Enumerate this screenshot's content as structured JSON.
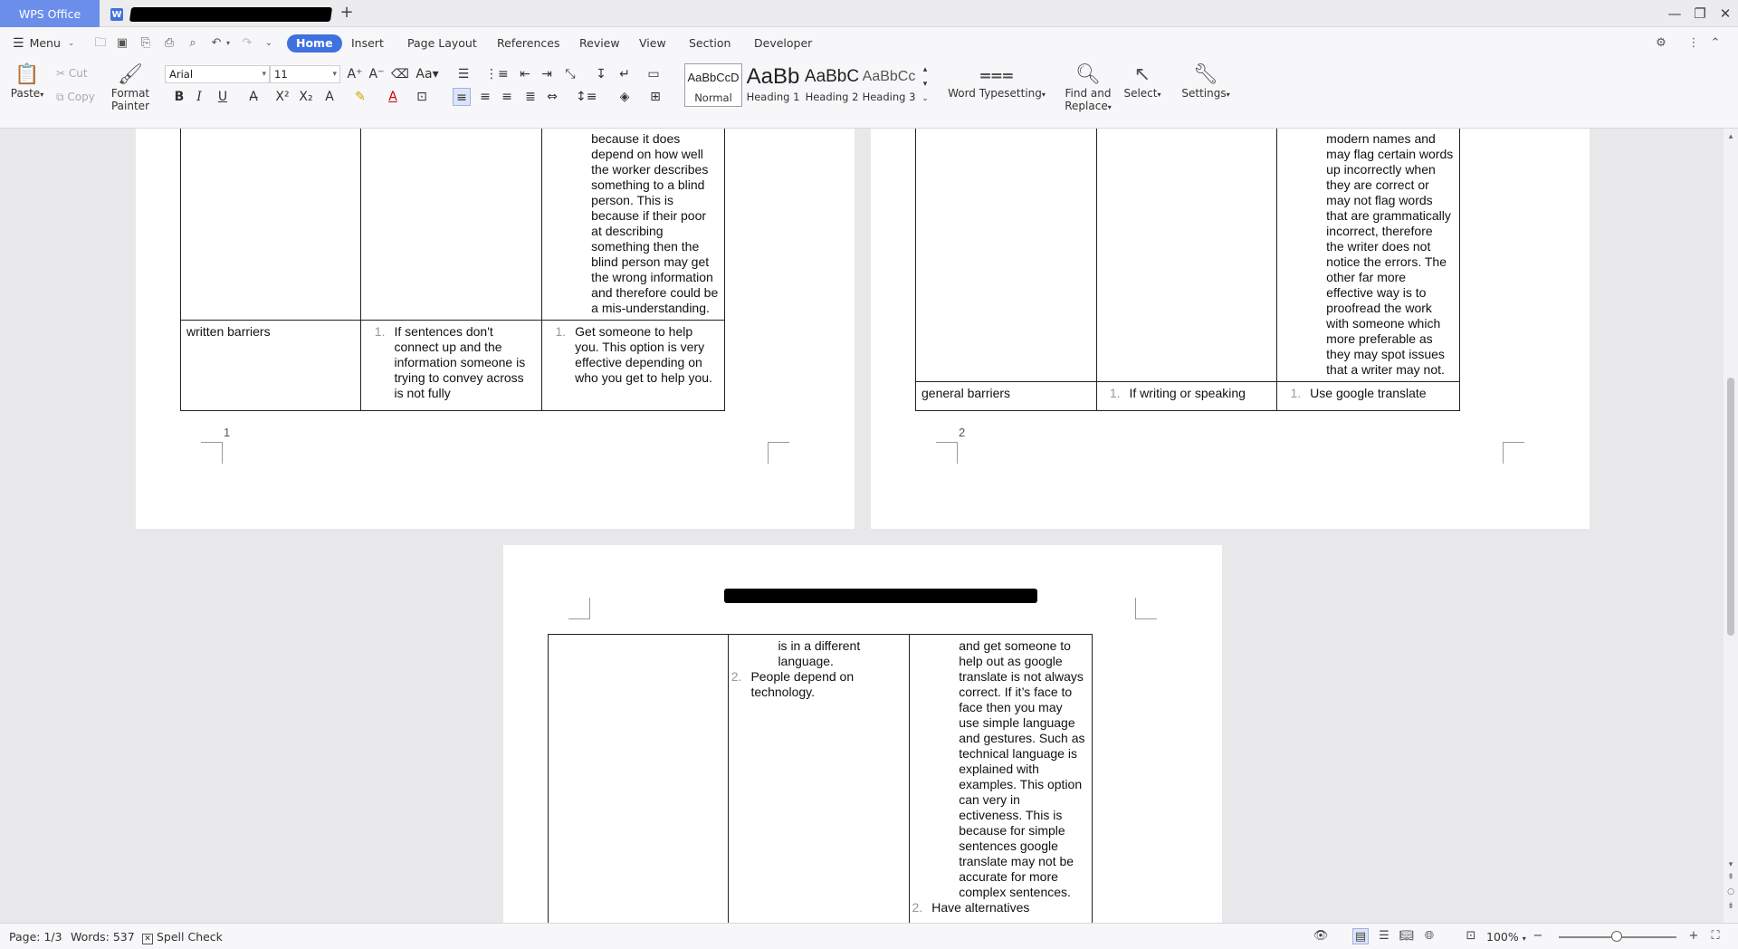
{
  "titlebar": {
    "app_tab": "WPS Office",
    "doc_icon": "W",
    "new_tab": "+",
    "minimize": "—",
    "restore": "❐",
    "close": "✕"
  },
  "menu": {
    "menu_label": "Menu",
    "tabs": [
      "Home",
      "Insert",
      "Page Layout",
      "References",
      "Review",
      "View",
      "Section",
      "Developer"
    ]
  },
  "ribbon": {
    "paste": "Paste",
    "cut": "Cut",
    "copy": "Copy",
    "format_painter_1": "Format",
    "format_painter_2": "Painter",
    "font_name": "Arial",
    "font_size": "11",
    "styles": [
      {
        "preview": "AaBbCcD",
        "label": "Normal"
      },
      {
        "preview": "AaBb",
        "label": "Heading 1"
      },
      {
        "preview": "AaBbC",
        "label": "Heading 2"
      },
      {
        "preview": "AaBbCc",
        "label": "Heading 3"
      }
    ],
    "word_typesetting": "Word Typesetting",
    "find_replace_1": "Find and",
    "find_replace_2": "Replace",
    "select": "Select",
    "settings": "Settings"
  },
  "pages": {
    "page1": {
      "row1_col3": "because it does depend on how well the worker describes something to a blind person. This is because if their poor at describing something then the blind person may get the wrong information and therefore could be a mis-understanding.",
      "row2_col1": "written barriers",
      "row2_col2_num": "1.",
      "row2_col2": "If sentences don't connect up and the information someone is trying to convey across is not fully",
      "row2_col3_num": "1.",
      "row2_col3": "Get someone to help you. This option is very effective depending on who you get to help you.",
      "page_number": "1"
    },
    "page2": {
      "row1_col3": "modern names and may flag certain words up incorrectly when they are correct or may not flag words that are grammatically incorrect, therefore the writer does not notice the errors. The other far more effective way is to proofread the work with someone which more preferable as they may spot issues that a writer may not.",
      "row2_col1": "general barriers",
      "row2_col2_num": "1.",
      "row2_col2": "If writing or speaking",
      "row2_col3_num": "1.",
      "row2_col3": "Use google translate",
      "page_number": "2"
    },
    "page3": {
      "col2_line1": "is in a different language.",
      "col2_num2": "2.",
      "col2_item2": "People depend on technology.",
      "col3_text": "and get someone to help out as google translate is not always correct. If it’s face to face then you may use simple language and gestures. Such as technical language is explained with examples. This option can very in ectiveness. This is because for simple sentences google translate may not be accurate for more complex sentences.",
      "col3_num2": "2.",
      "col3_item2": "Have alternatives"
    }
  },
  "status": {
    "page": "Page: 1/3",
    "words": "Words: 537",
    "spell_check": "Spell Check",
    "zoom": "100%"
  }
}
